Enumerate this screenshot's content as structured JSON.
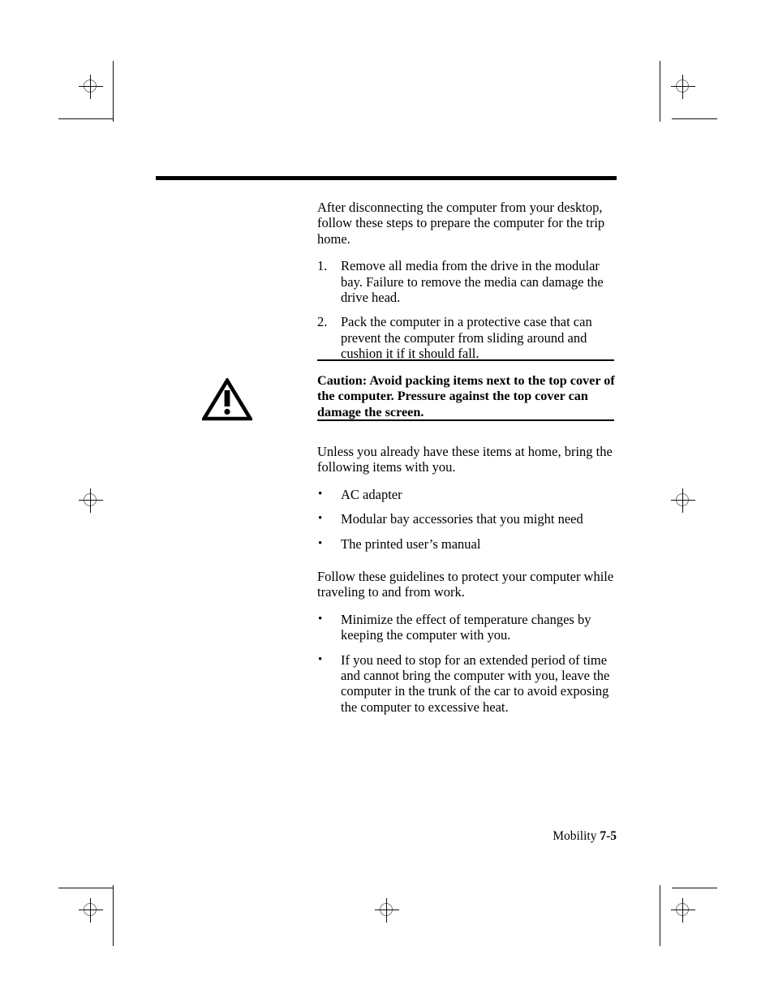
{
  "page": {
    "background": "#ffffff",
    "ink": "#000000"
  },
  "marks": {
    "registration_icon": "registration-crosshair",
    "description": "printer registration targets and trim marks"
  },
  "body": {
    "intro_paragraph": "After disconnecting the computer from your desktop, follow these steps to prepare the computer for the trip home.",
    "numbered_steps": [
      {
        "marker": "1.",
        "text": "Remove all media from the drive in the modular bay. Failure to remove the media can damage the drive head."
      },
      {
        "marker": "2.",
        "text": "Pack the computer in a protective case that can prevent the computer from sliding around and cushion it if it should fall."
      }
    ],
    "caution": {
      "icon": "warning-triangle-icon",
      "text": "Caution: Avoid packing items next to the top cover of the computer. Pressure against the top cover can damage the screen."
    },
    "items_paragraph": "Unless you already have these items at home, bring the following items with you.",
    "items_bullets": [
      {
        "marker": "•",
        "text": "AC adapter"
      },
      {
        "marker": "•",
        "text": "Modular bay accessories that you might need"
      },
      {
        "marker": "•",
        "text": "The printed user’s manual"
      }
    ],
    "guidelines_paragraph": "Follow these guidelines to protect your computer while traveling to and from work.",
    "guidelines_bullets": [
      {
        "marker": "•",
        "text": "Minimize the effect of temperature changes by keeping the computer with you."
      },
      {
        "marker": "•",
        "text": "If you need to stop for an extended period of time and cannot bring the computer with you, leave the computer in the trunk of the car to avoid exposing the computer to excessive heat."
      }
    ]
  },
  "footer": {
    "chapter": "Mobility ",
    "page_number": "7-5"
  }
}
